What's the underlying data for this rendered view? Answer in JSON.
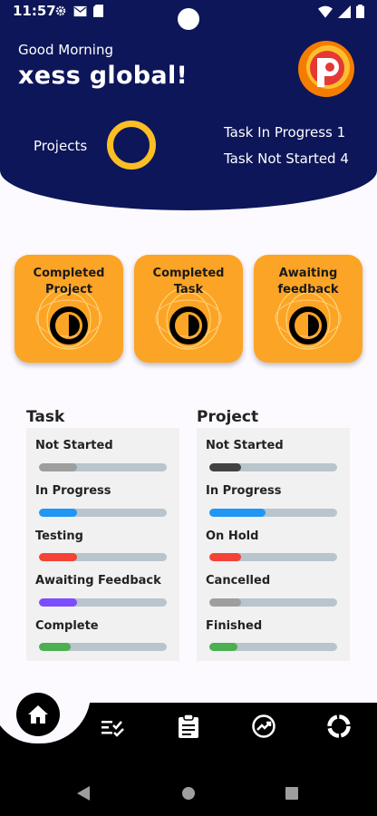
{
  "status_bar": {
    "time": "11:57",
    "icons_left": [
      "settings-icon",
      "mail-icon",
      "sim-icon"
    ],
    "icons_right": [
      "wifi-icon",
      "signal-icon",
      "battery-icon"
    ]
  },
  "header": {
    "greeting": "Good Morning",
    "user": "xess global!",
    "projects_label": "Projects",
    "tasks_in_progress": "Task In Progress 1",
    "tasks_not_started": "Task Not Started 4"
  },
  "cards": [
    {
      "title": "Completed Project"
    },
    {
      "title": "Completed Task"
    },
    {
      "title": "Awaiting feedback"
    }
  ],
  "task_panel": {
    "title": "Task",
    "rows": [
      {
        "label": "Not Started",
        "fill": 0.3,
        "color": "#9e9e9e"
      },
      {
        "label": "In Progress",
        "fill": 0.3,
        "color": "#2196f3"
      },
      {
        "label": "Testing",
        "fill": 0.3,
        "color": "#f44336"
      },
      {
        "label": "Awaiting Feedback",
        "fill": 0.3,
        "color": "#7c4dff"
      },
      {
        "label": "Complete",
        "fill": 0.25,
        "color": "#4caf50"
      }
    ]
  },
  "project_panel": {
    "title": "Project",
    "rows": [
      {
        "label": "Not Started",
        "fill": 0.25,
        "color": "#424242"
      },
      {
        "label": "In Progress",
        "fill": 0.44,
        "color": "#2196f3"
      },
      {
        "label": "On Hold",
        "fill": 0.25,
        "color": "#f44336"
      },
      {
        "label": "Cancelled",
        "fill": 0.25,
        "color": "#9e9e9e"
      },
      {
        "label": "Finished",
        "fill": 0.22,
        "color": "#4caf50"
      }
    ]
  },
  "bottom_nav": [
    "home-icon",
    "tasks-list-icon",
    "clipboard-icon",
    "trending-icon",
    "loading-ring-icon"
  ],
  "colors": {
    "primary": "#0d1659",
    "accent": "#fca425",
    "ring": "#fbbf24"
  }
}
